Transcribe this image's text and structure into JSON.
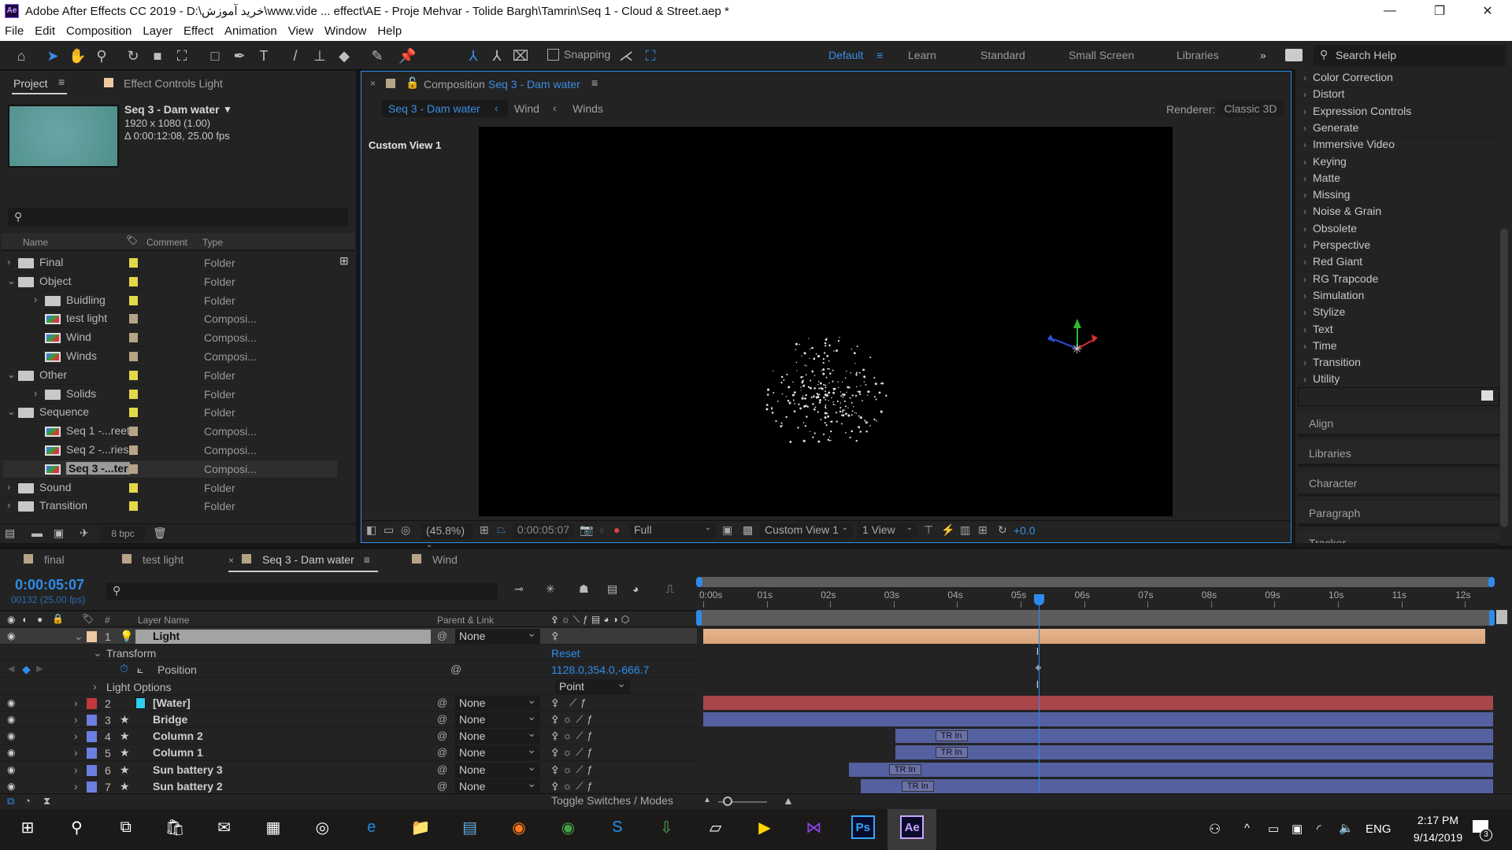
{
  "title": "Adobe After Effects CC 2019 - D:\\خرید آموزش\\www.vide ... effect\\AE - Proje Mehvar - Tolide Bargh\\Tamrin\\Seq 1 - Cloud & Street.aep *",
  "app_badge": "Ae",
  "menu": [
    "File",
    "Edit",
    "Composition",
    "Layer",
    "Effect",
    "Animation",
    "View",
    "Window",
    "Help"
  ],
  "toolbar": {
    "snapping": "Snapping",
    "workspaces": [
      "Default",
      "Learn",
      "Standard",
      "Small Screen",
      "Libraries"
    ],
    "active_workspace": "Default",
    "search_placeholder": "Search Help"
  },
  "project": {
    "tab": "Project",
    "effect_controls_tab": "Effect Controls Light",
    "comp_name": "Seq 3 - Dam water",
    "comp_size": "1920 x 1080 (1.00)",
    "comp_duration": "Δ 0:00:12:08, 25.00 fps",
    "thumbnail_color": "#4f8f8b",
    "columns": {
      "name": "Name",
      "comment": "Comment",
      "type": "Type"
    },
    "items": [
      {
        "name": "Final",
        "type": "Folder",
        "kind": "folder",
        "level": 0,
        "twirl": "›",
        "label": "#e3d84a"
      },
      {
        "name": "Object",
        "type": "Folder",
        "kind": "folder",
        "level": 0,
        "twirl": "⌄",
        "label": "#e3d84a"
      },
      {
        "name": "Buidling",
        "type": "Folder",
        "kind": "folder",
        "level": 1,
        "twirl": "›",
        "label": "#e3d84a"
      },
      {
        "name": "test light",
        "type": "Composi...",
        "kind": "comp",
        "level": 1,
        "twirl": "",
        "label": "#b7a486"
      },
      {
        "name": "Wind",
        "type": "Composi...",
        "kind": "comp",
        "level": 1,
        "twirl": "",
        "label": "#b7a486"
      },
      {
        "name": "Winds",
        "type": "Composi...",
        "kind": "comp",
        "level": 1,
        "twirl": "",
        "label": "#b7a486"
      },
      {
        "name": "Other",
        "type": "Folder",
        "kind": "folder",
        "level": 0,
        "twirl": "⌄",
        "label": "#e3d84a"
      },
      {
        "name": "Solids",
        "type": "Folder",
        "kind": "folder",
        "level": 1,
        "twirl": "›",
        "label": "#e3d84a"
      },
      {
        "name": "Sequence",
        "type": "Folder",
        "kind": "folder",
        "level": 0,
        "twirl": "⌄",
        "label": "#e3d84a"
      },
      {
        "name": "Seq 1 -...reet",
        "type": "Composi...",
        "kind": "comp",
        "level": 1,
        "twirl": "",
        "label": "#b7a486"
      },
      {
        "name": "Seq 2 -...ries",
        "type": "Composi...",
        "kind": "comp",
        "level": 1,
        "twirl": "",
        "label": "#b7a486"
      },
      {
        "name": "Seq 3 -...ter",
        "type": "Composi...",
        "kind": "comp",
        "level": 1,
        "twirl": "",
        "label": "#b7a486",
        "selected": true
      },
      {
        "name": "Sound",
        "type": "Folder",
        "kind": "folder",
        "level": 0,
        "twirl": "›",
        "label": "#e3d84a"
      },
      {
        "name": "Transition",
        "type": "Folder",
        "kind": "folder",
        "level": 0,
        "twirl": "›",
        "label": "#e3d84a"
      }
    ],
    "bpc": "8 bpc"
  },
  "comp": {
    "tab_prefix": "Composition",
    "name": "Seq 3 - Dam water",
    "breadcrumbs": [
      "Seq 3 - Dam water",
      "Wind",
      "Winds"
    ],
    "renderer_label": "Renderer:",
    "renderer": "Classic 3D",
    "view_label": "Custom View 1",
    "zoom": "(45.8%)",
    "timecode": "0:00:05:07",
    "resolution": "Full",
    "view": "Custom View 1",
    "view_layout": "1 View",
    "exposure": "+0.0"
  },
  "effects": {
    "categories": [
      "Color Correction",
      "Distort",
      "Expression Controls",
      "Generate",
      "Immersive Video",
      "Keying",
      "Matte",
      "Missing",
      "Noise & Grain",
      "Obsolete",
      "Perspective",
      "Red Giant",
      "RG Trapcode",
      "Simulation",
      "Stylize",
      "Text",
      "Time",
      "Transition",
      "Utility"
    ],
    "panels": [
      "Align",
      "Libraries",
      "Character",
      "Paragraph",
      "Tracker"
    ]
  },
  "timeline": {
    "tabs": [
      {
        "name": "final",
        "color": "#b7a486"
      },
      {
        "name": "test light",
        "color": "#b7a486"
      },
      {
        "name": "Seq 3 - Dam water",
        "color": "#b7a486",
        "active": true
      },
      {
        "name": "Wind",
        "color": "#b7a486"
      }
    ],
    "timecode": "0:00:05:07",
    "current_time_s": 5.28,
    "frame_info": "00132 (25.00 fps)",
    "columns": {
      "hash": "#",
      "layer_name": "Layer Name",
      "parent": "Parent & Link"
    },
    "ruler": [
      "0:00s",
      "01s",
      "02s",
      "03s",
      "04s",
      "05s",
      "06s",
      "07s",
      "08s",
      "09s",
      "10s",
      "11s",
      "12s"
    ],
    "duration_s": 12.32,
    "light_layer": {
      "num": "1",
      "name": "Light",
      "parent": "None",
      "label": "#f0c8a0"
    },
    "transform": {
      "label": "Transform",
      "reset": "Reset"
    },
    "position": {
      "label": "Position",
      "value": "1128.0,354.0,-666.7"
    },
    "light_options": {
      "label": "Light Options",
      "type": "Point"
    },
    "layers": [
      {
        "num": "2",
        "name": "[Water]",
        "parent": "None",
        "label": "#c0393b",
        "icon": "solid",
        "bar": "#a8464a",
        "start_s": 0
      },
      {
        "num": "3",
        "name": "Bridge",
        "parent": "None",
        "label": "#6c7fe0",
        "icon": "star",
        "bar": "#5560a0",
        "start_s": 0
      },
      {
        "num": "4",
        "name": "Column 2",
        "parent": "None",
        "label": "#6c7fe0",
        "icon": "star",
        "bar": "#5560a0",
        "start_s": 3.03,
        "marker": "TR In",
        "marker_s": 3.73
      },
      {
        "num": "5",
        "name": "Column 1",
        "parent": "None",
        "label": "#6c7fe0",
        "icon": "star",
        "bar": "#5560a0",
        "start_s": 3.03,
        "marker": "TR In",
        "marker_s": 3.73
      },
      {
        "num": "6",
        "name": "Sun battery 3",
        "parent": "None",
        "label": "#6c7fe0",
        "icon": "star",
        "bar": "#5560a0",
        "start_s": 2.3,
        "marker": "TR In",
        "marker_s": 3.0
      },
      {
        "num": "7",
        "name": "Sun battery 2",
        "parent": "None",
        "label": "#6c7fe0",
        "icon": "star",
        "bar": "#5560a0",
        "start_s": 2.48,
        "marker": "TR In",
        "marker_s": 3.2
      }
    ],
    "toggle_label": "Toggle Switches / Modes"
  },
  "taskbar": {
    "apps": [
      "start",
      "search",
      "task-view",
      "store",
      "mail",
      "calculator",
      "media-player",
      "edge",
      "file-explorer",
      "control-panel",
      "firefox",
      "chrome",
      "skype",
      "idm",
      "notepad",
      "kmplayer",
      "visual-studio",
      "photoshop",
      "after-effects"
    ],
    "lang": "ENG",
    "time": "2:17 PM",
    "date": "9/14/2019",
    "notifications": "3"
  },
  "colors": {
    "accent": "#2d8ceb",
    "panel": "#232323",
    "playhead": "#2d8ceb"
  }
}
